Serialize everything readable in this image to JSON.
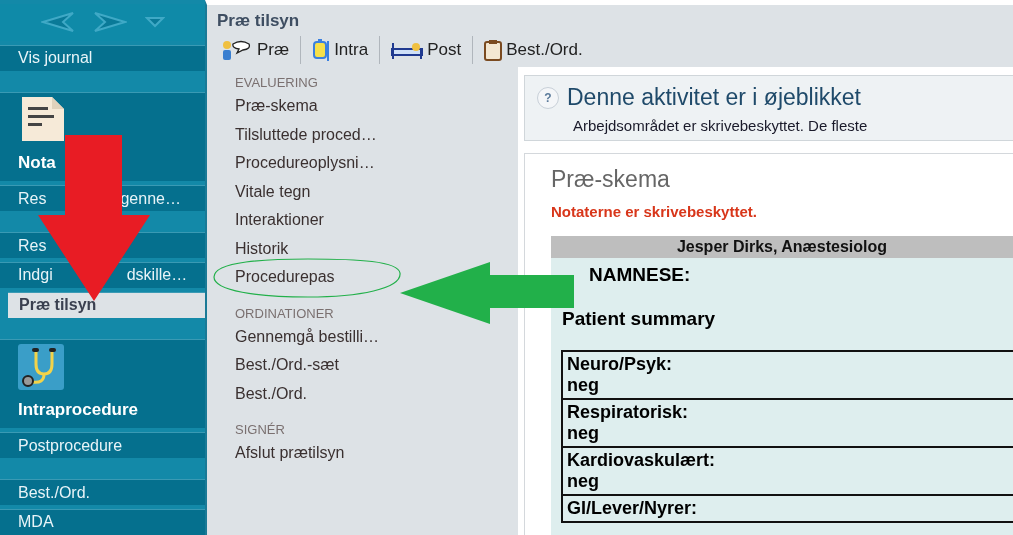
{
  "sidebar": {
    "items": [
      {
        "kind": "link",
        "parts": [
          "Vis journal"
        ],
        "selected": false
      },
      {
        "kind": "spacer"
      },
      {
        "kind": "big",
        "parts": [
          "Nota"
        ]
      },
      {
        "kind": "link",
        "parts": [
          "Res",
          "genne…"
        ],
        "selected": false
      },
      {
        "kind": "spacer"
      },
      {
        "kind": "link",
        "parts": [
          "Res"
        ],
        "selected": false
      },
      {
        "kind": "link",
        "parts": [
          "Indgi",
          "dskille…"
        ],
        "selected": false
      },
      {
        "kind": "link",
        "parts": [
          "Præ tilsyn"
        ],
        "selected": true
      },
      {
        "kind": "spacer"
      },
      {
        "kind": "big",
        "parts": [
          "Intraprocedure"
        ]
      },
      {
        "kind": "link",
        "parts": [
          "Postprocedure"
        ],
        "selected": false
      },
      {
        "kind": "spacer"
      },
      {
        "kind": "link",
        "parts": [
          "Best./Ord."
        ],
        "selected": false
      },
      {
        "kind": "link",
        "parts": [
          "MDA"
        ],
        "selected": false
      }
    ]
  },
  "window": {
    "title": "Præ tilsyn"
  },
  "toolbar": [
    {
      "label": "Præ"
    },
    {
      "label": "Intra"
    },
    {
      "label": "Post"
    },
    {
      "label": "Best./Ord."
    }
  ],
  "menu": [
    {
      "heading": "EVALUERING",
      "items": [
        {
          "label": "Præ-skema",
          "highlighted": false
        },
        {
          "label": "Tilsluttede proced…",
          "highlighted": false
        },
        {
          "label": "Procedureoplysni…",
          "highlighted": false
        },
        {
          "label": "Vitale tegn",
          "highlighted": false
        },
        {
          "label": "Interaktioner",
          "highlighted": false
        },
        {
          "label": "Historik",
          "highlighted": false
        },
        {
          "label": "Procedurepas",
          "highlighted": true
        }
      ]
    },
    {
      "heading": "ORDINATIONER",
      "items": [
        {
          "label": "Gennemgå bestilli…",
          "highlighted": false
        },
        {
          "label": "Best./Ord.-sæt",
          "highlighted": false
        },
        {
          "label": "Best./Ord.",
          "highlighted": false
        }
      ]
    },
    {
      "heading": "SIGNÉR",
      "items": [
        {
          "label": "Afslut prætilsyn",
          "highlighted": false
        }
      ]
    }
  ],
  "banner": {
    "help_mark": "?",
    "title": "Denne aktivitet er i øjeblikket",
    "text": "Arbejdsområdet er skrivebeskyttet. De fleste"
  },
  "form": {
    "title": "Præ-skema",
    "warning": "Notaterne er skrivebeskyttet.",
    "author": "Jesper Dirks, Anæstesiolog",
    "section": "NAMNESE:",
    "subtitle": "Patient summary",
    "rows": [
      {
        "label": "Neuro/Psyk:",
        "value": "neg"
      },
      {
        "label": "Respiratorisk:",
        "value": "neg"
      },
      {
        "label": "Kardiovaskulært:",
        "value": "neg"
      },
      {
        "label": "GI/Lever/Nyrer:"
      }
    ]
  }
}
